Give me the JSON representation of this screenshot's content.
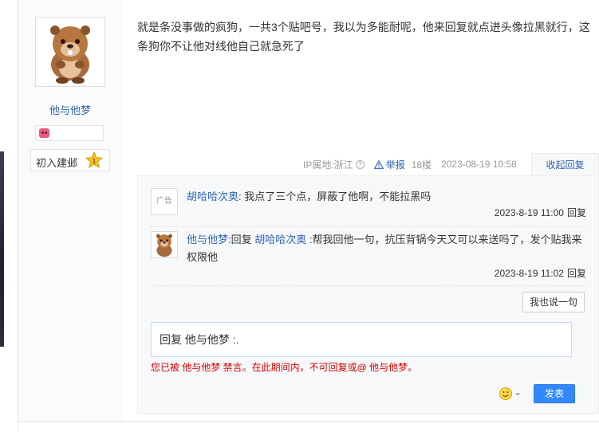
{
  "author": {
    "username": "他与他梦",
    "level_title": "初入建邺",
    "level_number": "1"
  },
  "post": {
    "content": "就是条没事做的疯狗，一共3个贴吧号，我以为多能耐呢，他来回复就点进头像拉黑就行，这条狗你不让他对线他自己就急死了",
    "ip_location": "IP属地:浙江",
    "help_icon_glyph": "?",
    "report_label": "举报",
    "floor": "18楼",
    "time": "2023-08-19 10:58",
    "collapse_label": "收起回复"
  },
  "comments": [
    {
      "avatar_text": "广告",
      "user": "胡哈哈次奥",
      "separator": ":",
      "text": " 我点了三个点，屏蔽了他啊，不能拉黑吗",
      "time": "2023-8-19 11:00",
      "reply_label": "回复"
    },
    {
      "user": "他与他梦",
      "separator": ":",
      "reply_prefix": "回复 ",
      "reply_to": "胡哈哈次奥",
      "text": " :帮我回他一句，抗压背锅今天又可以来送吗了，发个贴我来权限他",
      "time": "2023-8-19 11:02",
      "reply_label": "回复"
    }
  ],
  "reply_box": {
    "say_button": "我也说一句",
    "input_value": "回复 他与他梦 :.",
    "ban_notice": "您已被 他与他梦 禁言。在此期间内，不可回复或@ 他与他梦。",
    "send_button": "发表"
  },
  "colors": {
    "link_blue": "#2d64b3",
    "send_button": "#3388ff",
    "notice_red": "#d60000",
    "panel_bg": "#f7f8fa"
  },
  "icons": {
    "avatar": "beaver-avatar",
    "badge": "pig-icon",
    "level": "star-badge-icon",
    "help": "question-circle-icon",
    "report": "warning-triangle-icon",
    "emoji": "smiley-icon"
  }
}
